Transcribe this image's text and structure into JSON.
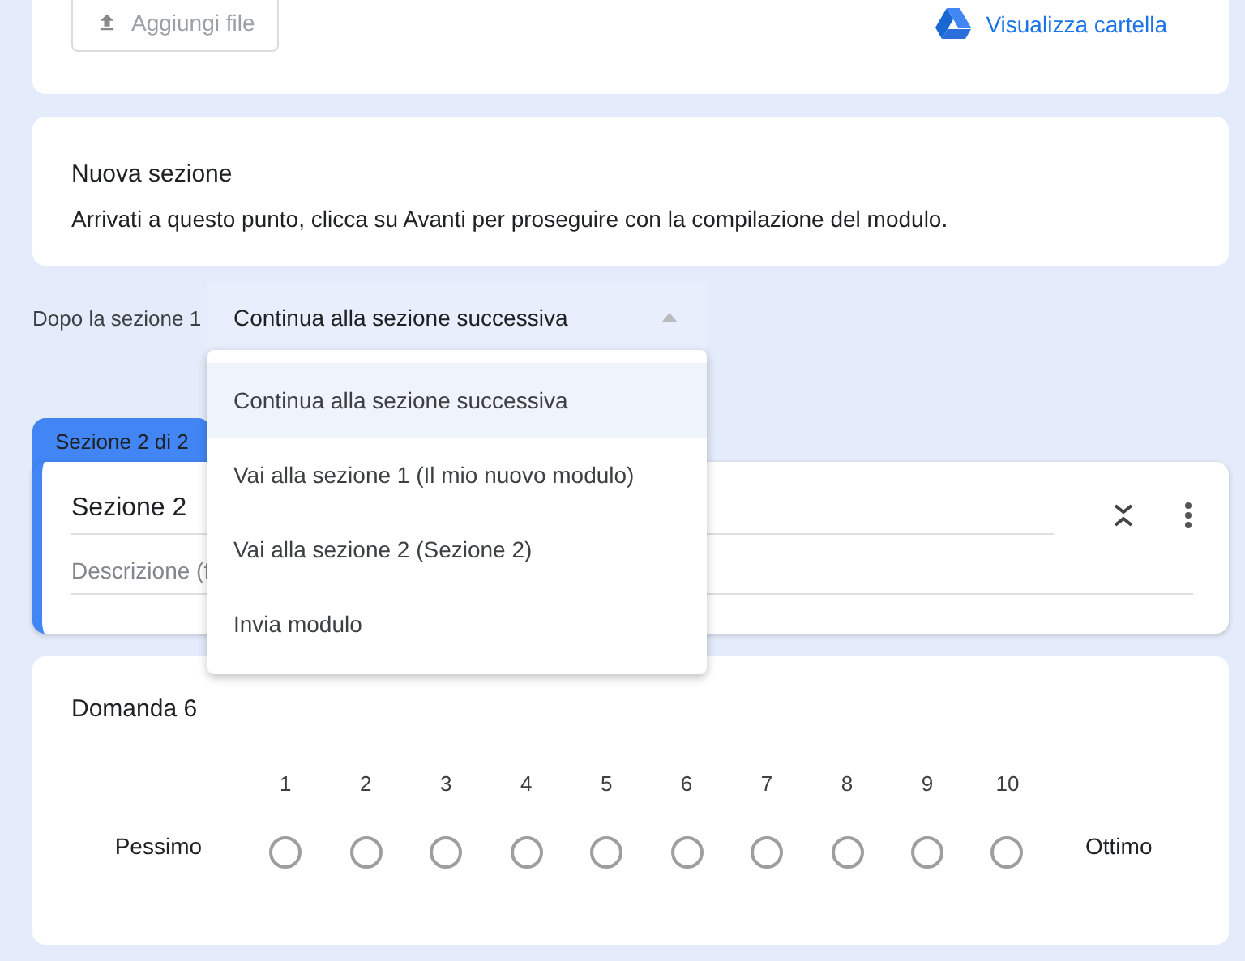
{
  "upload_card": {
    "add_file_button": "Aggiungi file",
    "view_folder_link": "Visualizza cartella"
  },
  "section_1": {
    "title": "Nuova sezione",
    "description": "Arrivati a questo punto, clicca su Avanti per proseguire con la compilazione del modulo."
  },
  "after_section": {
    "label": "Dopo la sezione 1",
    "value": "Continua alla sezione successiva",
    "expanded": true,
    "options": [
      {
        "label": "Continua alla sezione successiva",
        "selected": true
      },
      {
        "label": "Vai alla sezione 1 (Il mio nuovo modulo)",
        "selected": false
      },
      {
        "label": "Vai alla sezione 2 (Sezione 2)",
        "selected": false
      },
      {
        "label": "Invia modulo",
        "selected": false
      }
    ]
  },
  "section_2": {
    "tab": "Sezione 2 di 2",
    "title": "Sezione 2",
    "description_placeholder": "Descrizione (f"
  },
  "question": {
    "title": "Domanda 6",
    "scale": [
      {
        "label": "1",
        "selected": false
      },
      {
        "label": "2",
        "selected": false
      },
      {
        "label": "3",
        "selected": false
      },
      {
        "label": "4",
        "selected": false
      },
      {
        "label": "5",
        "selected": false
      },
      {
        "label": "6",
        "selected": false
      },
      {
        "label": "7",
        "selected": false
      },
      {
        "label": "8",
        "selected": false
      },
      {
        "label": "9",
        "selected": false
      },
      {
        "label": "10",
        "selected": false
      }
    ],
    "low_label": "Pessimo",
    "high_label": "Ottimo"
  }
}
